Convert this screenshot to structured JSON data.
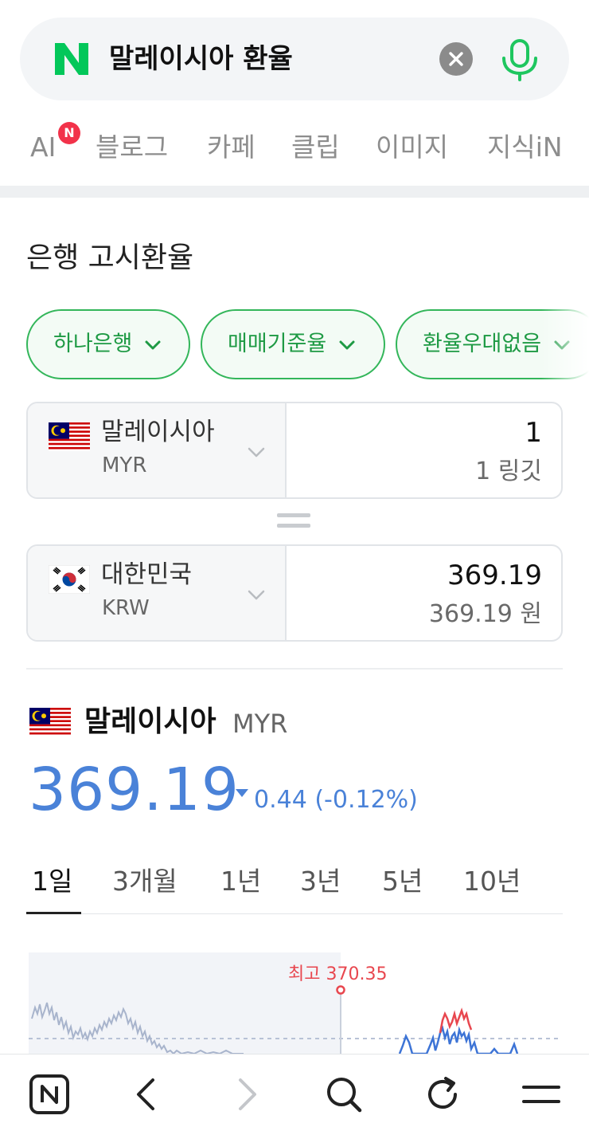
{
  "search": {
    "query": "말레이시아 환율",
    "logo_letter": "N"
  },
  "tabs": [
    {
      "label": "AI",
      "badge": "N"
    },
    {
      "label": "블로그"
    },
    {
      "label": "카페"
    },
    {
      "label": "클립"
    },
    {
      "label": "이미지"
    },
    {
      "label": "지식iN"
    }
  ],
  "section_title": "은행 고시환율",
  "filters": [
    {
      "label": "하나은행"
    },
    {
      "label": "매매기준율"
    },
    {
      "label": "환율우대없음"
    }
  ],
  "converter": {
    "from": {
      "country": "말레이시아",
      "code": "MYR",
      "amount": "1",
      "amount_text": "1 링깃"
    },
    "to": {
      "country": "대한민국",
      "code": "KRW",
      "amount": "369.19",
      "amount_text": "369.19 원"
    }
  },
  "rate": {
    "country": "말레이시아",
    "code": "MYR",
    "value": "369.19",
    "change": "0.44 (-0.12%)",
    "direction": "down"
  },
  "periods": [
    {
      "label": "1일",
      "active": true
    },
    {
      "label": "3개월"
    },
    {
      "label": "1년"
    },
    {
      "label": "3년"
    },
    {
      "label": "5년"
    },
    {
      "label": "10년"
    }
  ],
  "chart": {
    "max_label": "최고 370.35",
    "max_value": 370.35
  },
  "colors": {
    "naver_green": "#03c75a",
    "chip_green": "#1e9a44",
    "rate_blue": "#4a82d8",
    "max_red": "#e8474f",
    "badge_red": "#f2324a"
  },
  "bottom_nav": {
    "icons": [
      "naver-home-icon",
      "back-icon",
      "forward-icon",
      "search-icon",
      "refresh-icon",
      "menu-icon"
    ]
  }
}
